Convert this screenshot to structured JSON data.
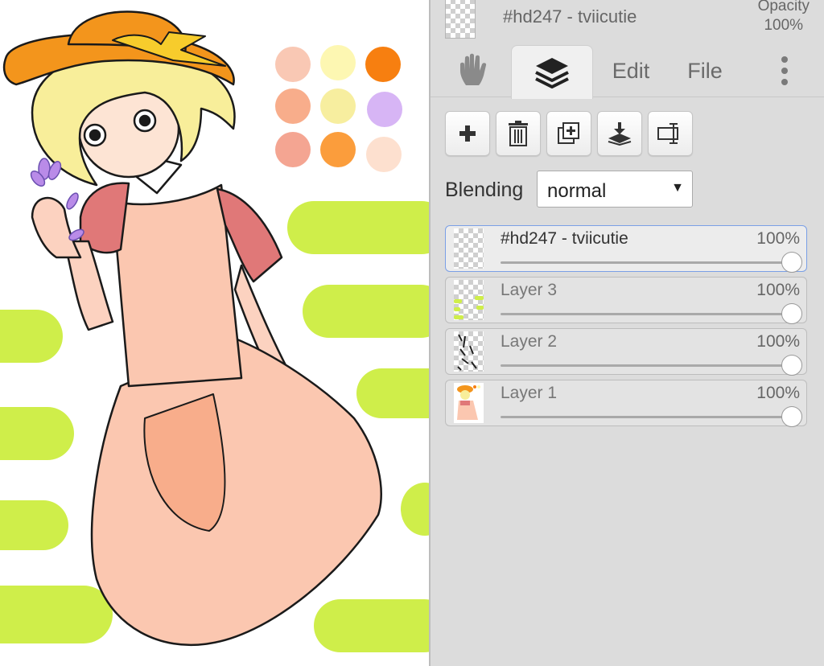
{
  "header": {
    "layer_name": "#hd247 - tviicutie",
    "opacity_label": "Opacity",
    "opacity_value": "100%"
  },
  "tabs": [
    {
      "label": "",
      "icon": "hand-icon"
    },
    {
      "label": "",
      "icon": "layers-icon",
      "active": true
    },
    {
      "label": "Edit"
    },
    {
      "label": "File"
    },
    {
      "label": "",
      "icon": "more-vertical-icon"
    }
  ],
  "toolbar": {
    "icons": [
      "plus-icon",
      "trash-icon",
      "duplicate-icon",
      "merge-down-icon",
      "rename-icon"
    ]
  },
  "blending": {
    "label": "Blending",
    "value": "normal"
  },
  "layers": [
    {
      "name": "#hd247 - tviicutie",
      "opacity": "100%",
      "opacity_fraction": 1.0,
      "selected": true
    },
    {
      "name": "Layer 3",
      "opacity": "100%",
      "opacity_fraction": 1.0
    },
    {
      "name": "Layer 2",
      "opacity": "100%",
      "opacity_fraction": 1.0
    },
    {
      "name": "Layer 1",
      "opacity": "100%",
      "opacity_fraction": 1.0
    }
  ],
  "colors": {
    "panel_bg": "#dcdcdc",
    "lime": "#cfee4a",
    "palette": [
      "#f9c8b4",
      "#fdf7b2",
      "#f77f10",
      "#f8ad8b",
      "#f7ee9f",
      "#d7b5f5",
      "#f4a592",
      "#fb9d3c",
      "#fde0cf"
    ]
  }
}
